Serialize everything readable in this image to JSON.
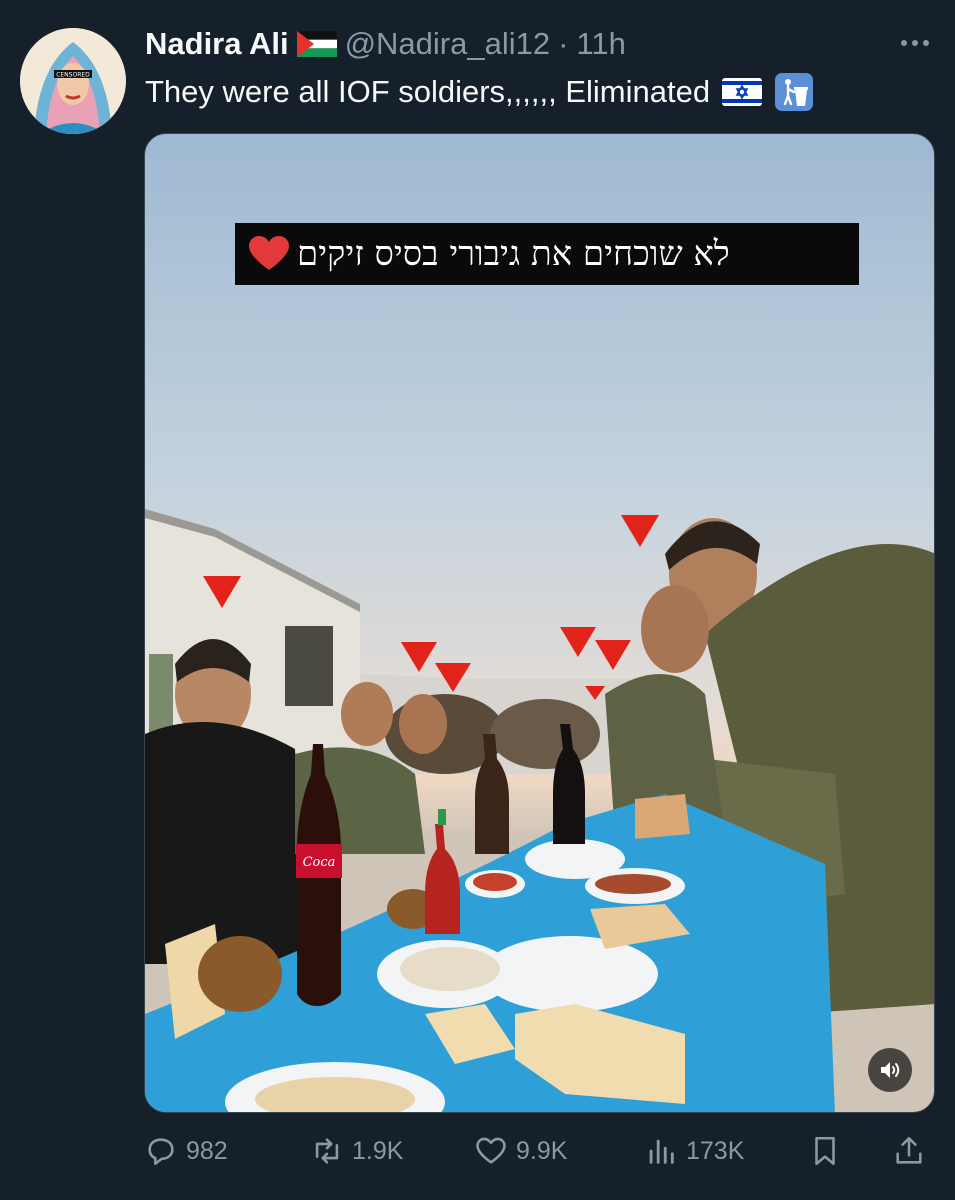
{
  "tweet": {
    "author": {
      "display_name": "Nadira Ali",
      "name_flag_icon": "palestine-flag-icon",
      "avatar_label": "CENSORED",
      "handle": "@Nadira_ali12",
      "separator": "·",
      "time": "11h"
    },
    "more_icon": "more-dots-icon",
    "text": "They were all IOF soldiers,,,,,, Eliminated",
    "text_icons": [
      "israel-flag-icon",
      "litter-in-bin-icon"
    ],
    "media": {
      "caption": "לא שוכחים את גיבורי בסיס זיקים",
      "caption_icon": "red-heart-icon",
      "mute_icon": "speaker-icon"
    },
    "actions": {
      "replies": "982",
      "retweets": "1.9K",
      "likes": "9.9K",
      "views": "173K"
    }
  },
  "colors": {
    "background": "#15202b",
    "text_primary": "#f7f9f9",
    "text_secondary": "#8b98a5"
  }
}
